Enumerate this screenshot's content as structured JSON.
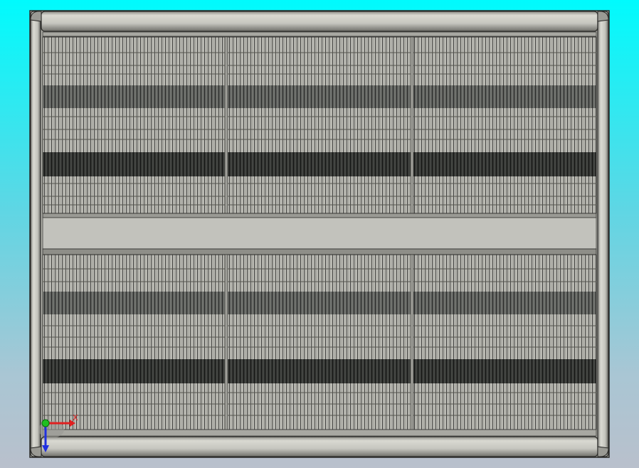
{
  "viewport": {
    "background_top": "#00fbfd",
    "background_bottom": "#b9c0cc"
  },
  "model": {
    "part": "radiator-grille-assembly",
    "view": "front",
    "frame_color": "#c8c8c0",
    "frame_edge_color": "#3a3a38",
    "fin_color": "#bdbdb5",
    "dark_band_color": "#2e302e",
    "mid_band_color": "#5a5c5a",
    "grille_panels": 2,
    "panel_columns": 3
  },
  "triad": {
    "x_label": "X",
    "x_color": "#e02020",
    "y_color": "#2030e0",
    "origin_color": "#20c020"
  }
}
